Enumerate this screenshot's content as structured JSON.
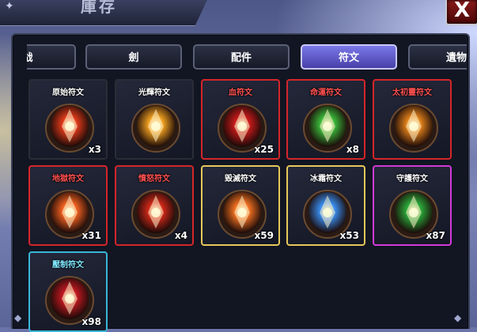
{
  "window": {
    "title": "庫存",
    "close_label": "X"
  },
  "tabs": [
    {
      "label": "战",
      "active": false
    },
    {
      "label": "劍",
      "active": false
    },
    {
      "label": "配件",
      "active": false
    },
    {
      "label": "符文",
      "active": true
    },
    {
      "label": "遺物",
      "active": false
    }
  ],
  "items": [
    {
      "name": "原始符文",
      "qty": "x3",
      "rarity": "dark",
      "color": "#e03a1a"
    },
    {
      "name": "光輝符文",
      "qty": "",
      "rarity": "dark",
      "color": "#f0a020"
    },
    {
      "name": "血符文",
      "qty": "x25",
      "rarity": "red",
      "color": "#c81a1a"
    },
    {
      "name": "命運符文",
      "qty": "x8",
      "rarity": "red",
      "color": "#3ab83a"
    },
    {
      "name": "太初靈符文",
      "qty": "",
      "rarity": "red",
      "color": "#e0801a"
    },
    {
      "name": "地獄符文",
      "qty": "x31",
      "rarity": "red",
      "color": "#f06020"
    },
    {
      "name": "憤怒符文",
      "qty": "x4",
      "rarity": "red",
      "color": "#d02818"
    },
    {
      "name": "毀滅符文",
      "qty": "x59",
      "rarity": "gold",
      "color": "#f07020"
    },
    {
      "name": "冰霜符文",
      "qty": "x53",
      "rarity": "gold",
      "color": "#3a8ef0"
    },
    {
      "name": "守護符文",
      "qty": "x87",
      "rarity": "purple",
      "color": "#2aa83a"
    },
    {
      "name": "壓制符文",
      "qty": "x98",
      "rarity": "cyan",
      "color": "#c01820"
    }
  ]
}
